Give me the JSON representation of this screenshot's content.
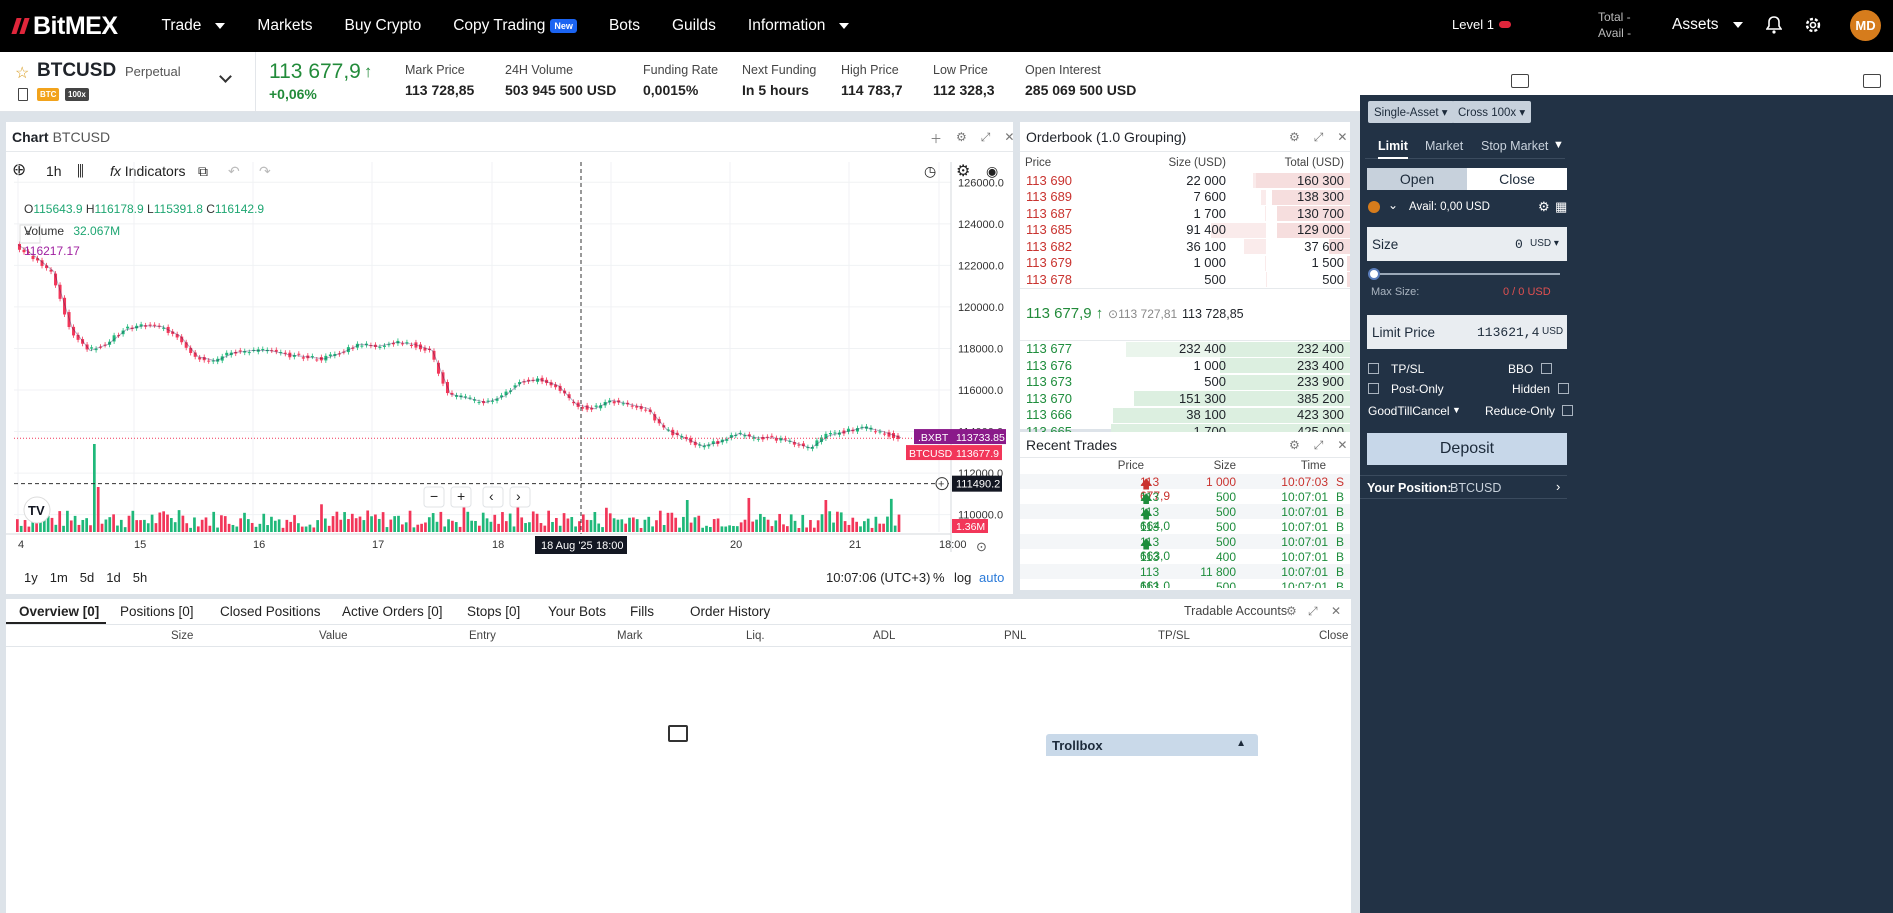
{
  "nav": {
    "logo": "BitMEX",
    "menu": [
      {
        "label": "Trade",
        "caret": true
      },
      {
        "label": "Markets"
      },
      {
        "label": "Buy Crypto"
      },
      {
        "label": "Copy Trading",
        "badge": "New"
      },
      {
        "label": "Bots"
      },
      {
        "label": "Guilds"
      },
      {
        "label": "Information",
        "caret": true
      }
    ],
    "level": "Level 1",
    "total": "Total  -",
    "avail": "Avail  -",
    "assets": "Assets",
    "avatar": "MD"
  },
  "ticker": {
    "symbol": "BTCUSD",
    "type": "Perpetual",
    "badge1": "BTC",
    "badge2": "100x",
    "price": "113 677,9",
    "change": "+0,06%",
    "stats": [
      {
        "label": "Mark Price",
        "value": "113 728,85"
      },
      {
        "label": "24H Volume",
        "value": "503 945 500 USD"
      },
      {
        "label": "Funding Rate",
        "value": "0,0015%"
      },
      {
        "label": "Next Funding",
        "value": "In 5 hours"
      },
      {
        "label": "High Price",
        "value": "114 783,7"
      },
      {
        "label": "Low Price",
        "value": "112 328,3"
      },
      {
        "label": "Open Interest",
        "value": "285 069 500 USD"
      }
    ]
  },
  "chart": {
    "title": "Chart",
    "symbol": "BTCUSD",
    "interval": "1h",
    "indicators": "Indicators",
    "o": "115643.9",
    "h": "116178.9",
    "l": "115391.8",
    "c": "116142.9",
    "volume_label": "Volume",
    "volume_value": "32.067M",
    "hi_marker": "116217.17",
    "bxbt_label": ".BXBT",
    "bxbt_value": "113733.85",
    "btc_label": "BTCUSD",
    "btc_value": "113677.9",
    "cross_value": "111490.2",
    "vol_tag": "1.36M",
    "crosshair_date": "18 Aug '25",
    "crosshair_time": "18:00",
    "ranges": [
      "1y",
      "1m",
      "5d",
      "1d",
      "5h"
    ],
    "clock": "10:07:06 (UTC+3)",
    "pct": "%",
    "log": "log",
    "auto": "auto"
  },
  "chart_data": {
    "type": "line",
    "title": "",
    "y_ticks": [
      "126000.0",
      "124000.0",
      "122000.0",
      "120000.0",
      "118000.0",
      "116000.0",
      "114000.0",
      "112000.0",
      "110000.0",
      "0"
    ],
    "x_ticks": [
      "4",
      "15",
      "16",
      "17",
      "18",
      "19",
      "20",
      "21",
      "18:00"
    ],
    "series": [
      {
        "values": [
          123000,
          122400,
          121700,
          119000,
          117900,
          118200,
          118900,
          119100,
          119050,
          118600,
          117600,
          117400,
          117800,
          117900,
          117900,
          117700,
          117600,
          117500,
          117800,
          118200,
          118100,
          118300,
          118200,
          117900,
          115800,
          115600,
          115400,
          115700,
          116400,
          116500,
          116200,
          115300,
          115100,
          115500,
          115300,
          115100,
          114100,
          113700,
          113300,
          113500,
          113900,
          113700,
          113700,
          113500,
          113200,
          113800,
          114000,
          114200,
          114000,
          113700
        ]
      }
    ],
    "ylim": [
      108200,
      126400
    ]
  },
  "orderbook": {
    "title": "Orderbook (1.0 Grouping)",
    "cols": [
      "Price",
      "Size (USD)",
      "Total (USD)"
    ],
    "asks": [
      {
        "p": "113 690",
        "s": "22 000",
        "t": "160 300",
        "w": 0.36
      },
      {
        "p": "113 689",
        "s": "7 600",
        "t": "138 300",
        "w": 0.3
      },
      {
        "p": "113 687",
        "s": "1 700",
        "t": "130 700",
        "w": 0.28
      },
      {
        "p": "113 685",
        "s": "91 400",
        "t": "129 000",
        "w": 0.28
      },
      {
        "p": "113 682",
        "s": "36 100",
        "t": "37 600",
        "w": 0.08
      },
      {
        "p": "113 679",
        "s": "1 000",
        "t": "1 500",
        "w": 0.01
      },
      {
        "p": "113 678",
        "s": "500",
        "t": "500",
        "w": 0.01
      }
    ],
    "last": "113 677,9",
    "mark": "113 727,81",
    "index": "113 728,85",
    "bids": [
      {
        "p": "113 677",
        "s": "232 400",
        "t": "232 400",
        "w": 0.5
      },
      {
        "p": "113 676",
        "s": "1 000",
        "t": "233 400",
        "w": 0.5
      },
      {
        "p": "113 673",
        "s": "500",
        "t": "233 900",
        "w": 0.5
      },
      {
        "p": "113 670",
        "s": "151 300",
        "t": "385 200",
        "w": 0.83
      },
      {
        "p": "113 666",
        "s": "38 100",
        "t": "423 300",
        "w": 0.91
      },
      {
        "p": "113 665",
        "s": "1 700",
        "t": "425 000",
        "w": 0.92
      },
      {
        "p": "113 663",
        "s": "40 100",
        "t": "465 100",
        "w": 1.0
      }
    ]
  },
  "trades": {
    "title": "Recent Trades",
    "cols": [
      "Price",
      "Size",
      "Time"
    ],
    "rows": [
      {
        "p": "113 677,9",
        "s": "1 000",
        "t": "10:07:03",
        "d": "S",
        "up": true
      },
      {
        "p": "113 664,5",
        "s": "500",
        "t": "10:07:01",
        "d": "B",
        "up": true
      },
      {
        "p": "113 664,0",
        "s": "500",
        "t": "10:07:01",
        "d": "B",
        "up": true
      },
      {
        "p": "113 663,0",
        "s": "500",
        "t": "10:07:01",
        "d": "B",
        "up": false
      },
      {
        "p": "113 663,0",
        "s": "500",
        "t": "10:07:01",
        "d": "B",
        "up": true
      },
      {
        "p": "113 661,0",
        "s": "400",
        "t": "10:07:01",
        "d": "B",
        "up": false
      },
      {
        "p": "113 661,0",
        "s": "11 800",
        "t": "10:07:01",
        "d": "B",
        "up": false
      },
      {
        "p": "113 661,0",
        "s": "500",
        "t": "10:07:01",
        "d": "B",
        "up": false
      }
    ]
  },
  "order": {
    "single": "Single-Asset",
    "cross": "Cross 100x",
    "types": [
      "Limit",
      "Market",
      "Stop Market"
    ],
    "open": "Open",
    "close": "Close",
    "avail": "Avail: 0,00 USD",
    "size_label": "Size",
    "size_value": "0",
    "usd": "USD",
    "max_label": "Max Size:",
    "max_value": "0 / 0 USD",
    "limit_label": "Limit Price",
    "limit_value": "113621,4",
    "tpsl": "TP/SL",
    "bbo": "BBO",
    "post": "Post-Only",
    "hidden": "Hidden",
    "gtc": "GoodTillCancel",
    "reduce": "Reduce-Only",
    "deposit": "Deposit",
    "pos_label": "Your Position:",
    "pos_sym": "BTCUSD"
  },
  "bottom": {
    "tabs": [
      "Overview [0]",
      "Positions [0]",
      "Closed Positions",
      "Active Orders [0]",
      "Stops [0]",
      "Your Bots",
      "Fills",
      "Order History"
    ],
    "accounts": "Tradable Accounts",
    "cols": [
      "Size",
      "Value",
      "Entry",
      "Mark",
      "Liq.",
      "ADL",
      "PNL",
      "TP/SL",
      "Close"
    ]
  },
  "trollbox": "Trollbox"
}
